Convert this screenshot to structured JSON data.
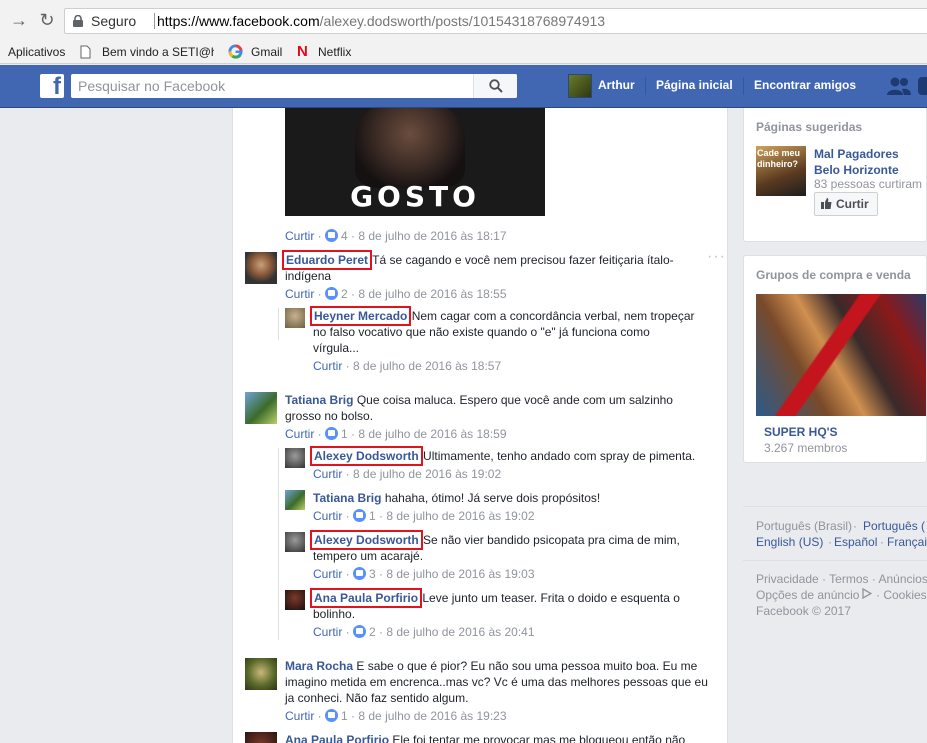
{
  "browser": {
    "secure_label": "Seguro",
    "url_domain": "https://www.facebook.com",
    "url_path": "/alexey.dodsworth/posts/10154318768974913",
    "bookmarks": [
      "Aplicativos",
      "Bem vindo a SETI@h",
      "Gmail",
      "Netflix"
    ]
  },
  "fb_nav": {
    "search_placeholder": "Pesquisar no Facebook",
    "user_name": "Arthur",
    "home": "Página inicial",
    "find_friends": "Encontrar amigos"
  },
  "post_image_text": "GOSTO ASSIM",
  "top_meta": {
    "action": "Curtir",
    "likes": "4",
    "time": "8 de julho de 2016 às 18:17"
  },
  "comments": [
    {
      "id": "c1",
      "author": "Eduardo Peret",
      "boxed": true,
      "text": "Tá se cagando e você nem precisou fazer feitiçaria ítalo-indígena",
      "action": "Curtir",
      "likes": "2",
      "time": "8 de julho de 2016 às 18:55",
      "replies": [
        {
          "author": "Heyner Mercado",
          "boxed": true,
          "text": "Nem cagar com a concordância verbal, nem tropeçar no falso vocativo que não existe quando o \"e\" já funciona como vírgula...",
          "action": "Curtir",
          "likes": "",
          "time": "8 de julho de 2016 às 18:57"
        }
      ]
    },
    {
      "id": "c2",
      "author": "Tatiana Brig",
      "boxed": false,
      "text": "Que coisa maluca. Espero que você ande com um salzinho grosso no bolso.",
      "action": "Curtir",
      "likes": "1",
      "time": "8 de julho de 2016 às 18:59",
      "replies": [
        {
          "author": "Alexey Dodsworth",
          "boxed": true,
          "text": "Ultimamente, tenho andado com spray de pimenta.",
          "action": "Curtir",
          "likes": "",
          "time": "8 de julho de 2016 às 19:02"
        },
        {
          "author": "Tatiana Brig",
          "boxed": false,
          "text": "hahaha, ótimo! Já serve dois propósitos!",
          "action": "Curtir",
          "likes": "1",
          "time": "8 de julho de 2016 às 19:02"
        },
        {
          "author": "Alexey Dodsworth",
          "boxed": true,
          "text": "Se não vier bandido psicopata pra cima de mim, tempero um acarajé.",
          "action": "Curtir",
          "likes": "3",
          "time": "8 de julho de 2016 às 19:03"
        },
        {
          "author": "Ana Paula Porfirio",
          "boxed": true,
          "text": "Leve junto um teaser. Frita o doido e esquenta o bolinho.",
          "action": "Curtir",
          "likes": "2",
          "time": "8 de julho de 2016 às 20:41"
        }
      ]
    },
    {
      "id": "c3",
      "author": "Mara Rocha",
      "boxed": false,
      "text": "E sabe o que é pior? Eu não sou uma pessoa muito boa. Eu me imagino metida em encrenca..mas vc? Vc é uma das melhores pessoas que eu ja conheci. Não faz sentido algum.",
      "action": "Curtir",
      "likes": "1",
      "time": "8 de julho de 2016 às 19:23"
    },
    {
      "id": "c4",
      "author": "Ana Paula Porfirio",
      "boxed": false,
      "text": "Ele foi tentar me provocar mas me bloqueou então não",
      "action": "",
      "likes": "",
      "time": ""
    }
  ],
  "sidebar": {
    "suggested_title": "Páginas sugeridas",
    "suggested_page_name": "Mal Pagadores Belo Horizonte",
    "suggested_page_likes": "83 pessoas curtiram",
    "suggested_page_thumb_text": "Cade meu dinheiro?",
    "like_button": "Curtir",
    "groups_title": "Grupos de compra e venda",
    "group_name": "SUPER HQ'S",
    "group_members": "3.267 membros",
    "languages": [
      "Português (Brasil)",
      "Português (",
      "English (US)",
      "Español",
      "Françai"
    ],
    "footer_line1": "Privacidade · Termos · Anúncios",
    "footer_line2": "Opções de anúncio",
    "footer_line2b": "· Cookies",
    "footer_copyright": "Facebook © 2017"
  },
  "colors": {
    "fb_blue": "#4267b2",
    "link": "#385898",
    "highlight_box": "#e0141e"
  }
}
